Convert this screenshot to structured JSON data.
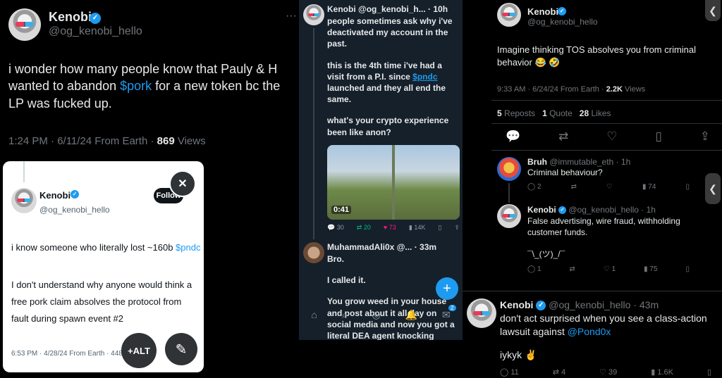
{
  "left": {
    "name": "Kenobi",
    "handle": "@og_kenobi_hello",
    "text_a": "i wonder how many people know that Pauly & H wanted to abandon ",
    "cashtag": "$pork",
    "text_b": " for a new token bc the LP was fucked up.",
    "meta_time": "1:24 PM · 6/11/24 From Earth · ",
    "meta_views": "869",
    "meta_views_label": " Views",
    "more": "···"
  },
  "card": {
    "name": "Kenobi",
    "handle": "@og_kenobi_hello",
    "follow_label": "Follow",
    "close_label": "✕",
    "line1": "i know someone who literally lost ~160b ",
    "line1_tag": "$pndc",
    "line2": "I don't understand why anyone would think a free pork claim absolves the protocol from fault during spawn event #2",
    "meta": "6:53 PM · 4/28/24 From Earth · 448 Views",
    "alt_label": "+ALT",
    "edit_icon": "pencil-icon"
  },
  "middle": {
    "header": "Kenobi @og_kenobi_h... · 10h",
    "p1": "people sometimes ask why i've deactivated my account in the past.",
    "p2a": "this is the 4th time i've had a visit from a P.I. since ",
    "p2tag": "$pndc",
    "p2b": " launched and they all end the same.",
    "p3": "what's your crypto experience been like anon?",
    "duration": "0:41",
    "stats": {
      "replies": "30",
      "reposts": "20",
      "likes": "73",
      "views": "14K"
    },
    "reply_header": "MuhammadAli0x @... · 33m",
    "reply_l1": "Bro.",
    "reply_l2": "I called it.",
    "reply_l3": "You grow weed in your house and post about it all day on social media and now you got a literal DEA agent knocking",
    "fab": "+",
    "notif_count": "2"
  },
  "right_top": {
    "name": "Kenobi",
    "handle": "@og_kenobi_hello",
    "text": "Imagine thinking TOS absolves you from criminal behavior 😂 🤣",
    "meta_time": "9:33 AM · 6/24/24 From Earth · ",
    "views": "2.2K",
    "views_label": " Views",
    "reposts": "5",
    "reposts_label": " Reposts",
    "quotes": "1",
    "quotes_label": " Quote",
    "likes": "28",
    "likes_label": " Likes",
    "reply1": {
      "name": "Bruh",
      "handle": "@immutable_eth · 1h",
      "text": "Criminal behaviour?",
      "replies": "2",
      "views": "74"
    },
    "reply2": {
      "name": "Kenobi",
      "handle": "@og_kenobi_hello · 1h",
      "text": "False advertising, wire fraud, withholding customer funds.",
      "shrug": "¯\\_(ツ)_/¯",
      "replies": "1",
      "likes": "1",
      "views": "75"
    },
    "back_glyph": "❮"
  },
  "right_bottom": {
    "name": "Kenobi",
    "handle": "@og_kenobi_hello · 43m",
    "text_a": "don't act surprised when you see a class-action lawsuit against ",
    "mention": "@Pond0x",
    "text_b": "iykyk ✌",
    "replies": "11",
    "reposts": "4",
    "likes": "39",
    "views": "1.6K"
  },
  "colors": {
    "accent": "#1d9bf0",
    "like_pink": "#f91880",
    "repost_green": "#00ba7c",
    "mid_bg": "#15202b"
  }
}
